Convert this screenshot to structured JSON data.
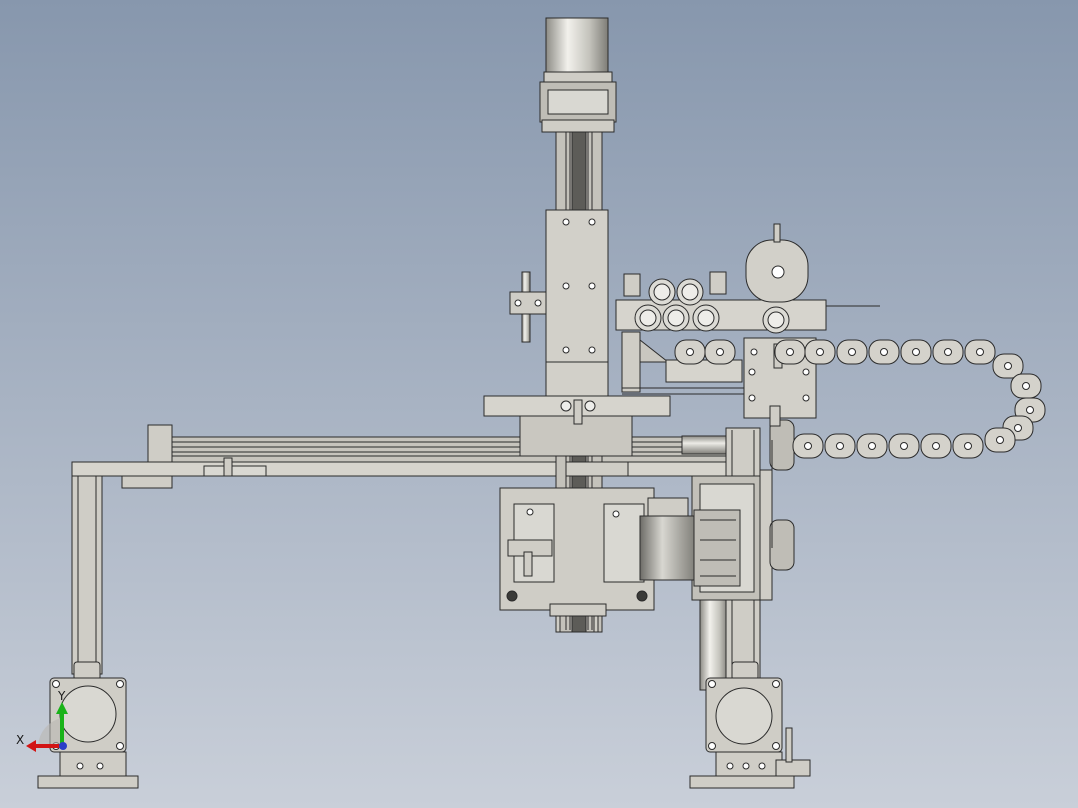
{
  "viewport": {
    "background_top": "#8797ad",
    "background_bottom": "#c9cfd9"
  },
  "palette": {
    "metal": "#cfcdc6",
    "metal_dark": "#9c9a92",
    "outline": "#2b2b2b",
    "shaft": "#b9b8b2"
  },
  "triad": {
    "x_label": "X",
    "y_label": "Y",
    "x_color": "#d21414",
    "y_color": "#19b319",
    "z_color": "#2a3fc8"
  }
}
